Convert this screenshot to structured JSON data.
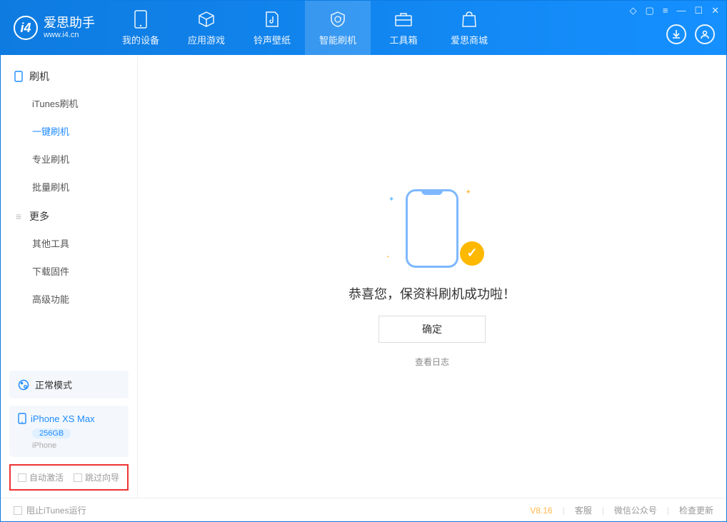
{
  "app": {
    "name": "爱思助手",
    "url": "www.i4.cn"
  },
  "tabs": [
    {
      "label": "我的设备"
    },
    {
      "label": "应用游戏"
    },
    {
      "label": "铃声壁纸"
    },
    {
      "label": "智能刷机"
    },
    {
      "label": "工具箱"
    },
    {
      "label": "爱思商城"
    }
  ],
  "sidebar": {
    "section1_title": "刷机",
    "section1_items": [
      {
        "label": "iTunes刷机"
      },
      {
        "label": "一键刷机"
      },
      {
        "label": "专业刷机"
      },
      {
        "label": "批量刷机"
      }
    ],
    "section2_title": "更多",
    "section2_items": [
      {
        "label": "其他工具"
      },
      {
        "label": "下载固件"
      },
      {
        "label": "高级功能"
      }
    ],
    "mode": "正常模式",
    "device_name": "iPhone XS Max",
    "device_capacity": "256GB",
    "device_type": "iPhone",
    "chk1": "自动激活",
    "chk2": "跳过向导"
  },
  "main": {
    "success": "恭喜您，保资料刷机成功啦！",
    "confirm": "确定",
    "view_log": "查看日志"
  },
  "footer": {
    "block_itunes": "阻止iTunes运行",
    "version": "V8.16",
    "links": [
      "客服",
      "微信公众号",
      "检查更新"
    ]
  }
}
